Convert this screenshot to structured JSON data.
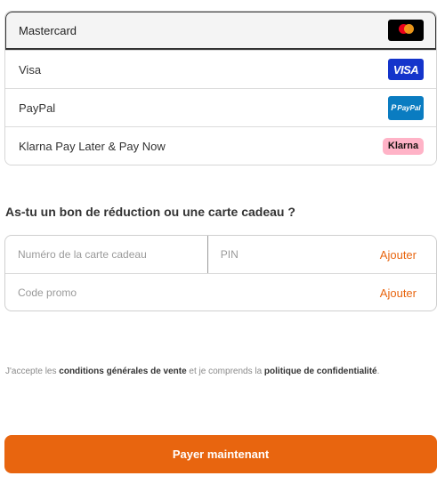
{
  "payment_methods": [
    {
      "label": "Mastercard",
      "logo": "mastercard-logo",
      "selected": true
    },
    {
      "label": "Visa",
      "logo": "visa-logo",
      "logo_text": "VISA",
      "selected": false
    },
    {
      "label": "PayPal",
      "logo": "paypal-logo",
      "logo_text": "PayPal",
      "selected": false
    },
    {
      "label": "Klarna Pay Later & Pay Now",
      "logo": "klarna-logo",
      "logo_text": "Klarna",
      "selected": false
    }
  ],
  "discount": {
    "title": "As-tu un bon de réduction ou une carte cadeau ?",
    "gift_card_placeholder": "Numéro de la carte cadeau",
    "pin_placeholder": "PIN",
    "gift_add_label": "Ajouter",
    "promo_placeholder": "Code promo",
    "promo_add_label": "Ajouter"
  },
  "terms": {
    "prefix": "J'accepte les ",
    "conditions_link": "conditions générales de vente",
    "middle": " et je comprends la ",
    "privacy_link": "politique de confidentialité",
    "suffix": "."
  },
  "pay_button_label": "Payer maintenant",
  "colors": {
    "accent": "#e8650f",
    "visa": "#1434cb",
    "paypal": "#0a7cc1",
    "klarna": "#ffb3c7"
  }
}
